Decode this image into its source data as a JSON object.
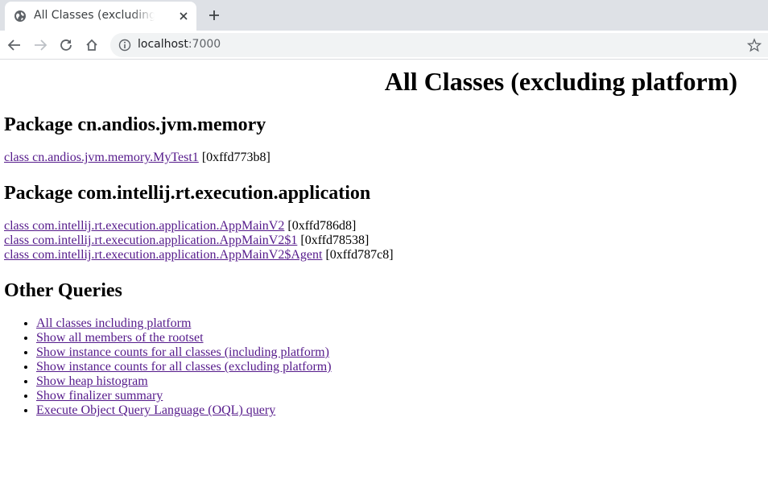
{
  "browser": {
    "tab_title": "All Classes (excluding platform)",
    "url_host": "localhost",
    "url_port": ":7000"
  },
  "page": {
    "title": "All Classes (excluding platform)",
    "packages": [
      {
        "heading": "Package cn.andios.jvm.memory",
        "classes": [
          {
            "link": "class cn.andios.jvm.memory.MyTest1",
            "addr": " [0xffd773b8]"
          }
        ]
      },
      {
        "heading": "Package com.intellij.rt.execution.application",
        "classes": [
          {
            "link": "class com.intellij.rt.execution.application.AppMainV2",
            "addr": " [0xffd786d8]"
          },
          {
            "link": "class com.intellij.rt.execution.application.AppMainV2$1",
            "addr": " [0xffd78538]"
          },
          {
            "link": "class com.intellij.rt.execution.application.AppMainV2$Agent",
            "addr": " [0xffd787c8]"
          }
        ]
      }
    ],
    "other_queries_heading": "Other Queries",
    "other_queries": [
      "All classes including platform",
      "Show all members of the rootset",
      "Show instance counts for all classes (including platform)",
      "Show instance counts for all classes (excluding platform)",
      "Show heap histogram",
      "Show finalizer summary",
      "Execute Object Query Language (OQL) query"
    ]
  }
}
